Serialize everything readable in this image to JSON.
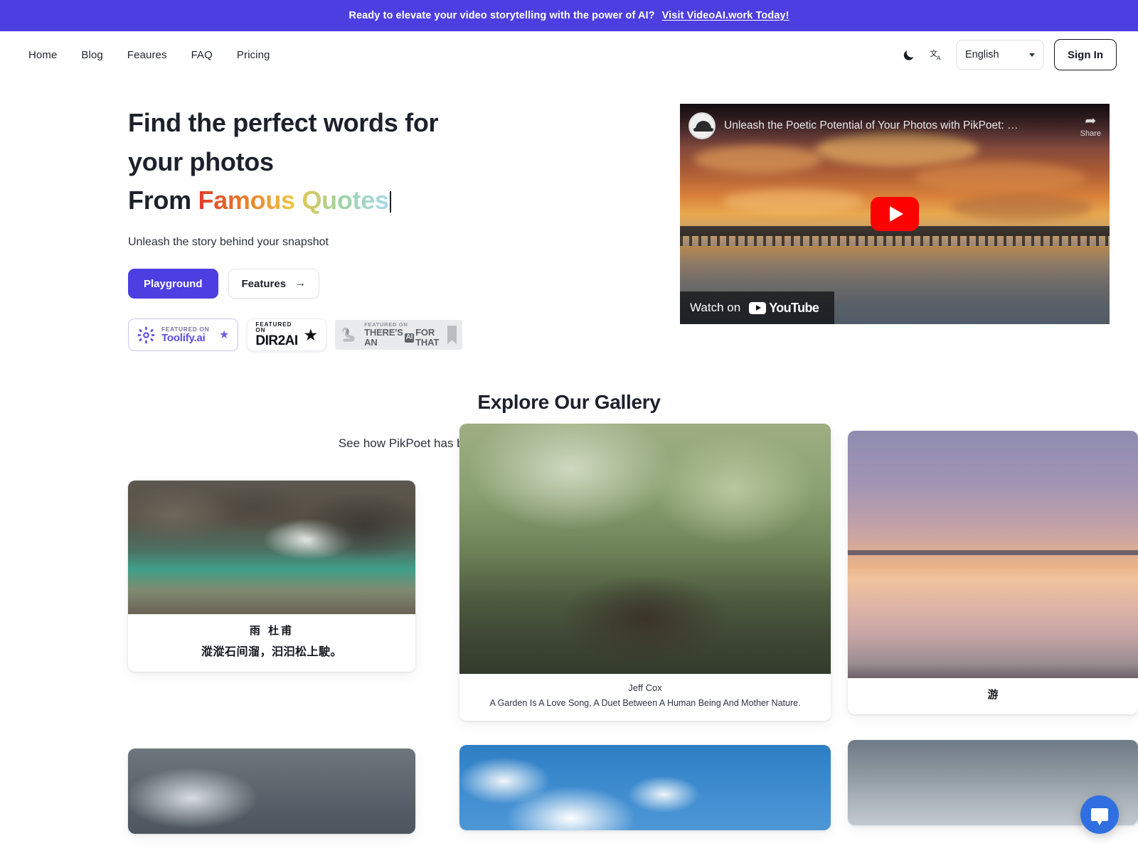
{
  "promo": {
    "text": "Ready to elevate your video storytelling with the power of AI?",
    "link_label": "Visit VideoAI.work Today!",
    "bg_color": "#4c3ee0"
  },
  "header": {
    "nav": [
      {
        "label": "Home"
      },
      {
        "label": "Blog"
      },
      {
        "label": "Feaures"
      },
      {
        "label": "FAQ"
      },
      {
        "label": "Pricing"
      }
    ],
    "theme_toggle_icon": "moon-icon",
    "translate_icon": "translate-icon",
    "language": {
      "value": "English"
    },
    "sign_in_label": "Sign In"
  },
  "hero": {
    "heading_line1": "Find the perfect words for your photos",
    "heading_line2_prefix": "From ",
    "heading_line2_gradient": "Famous Quotes",
    "subtitle": "Unleash the story behind your snapshot",
    "primary_button": "Playground",
    "secondary_button": "Features",
    "secondary_button_icon": "arrow-right-icon",
    "badges": [
      {
        "id": "toolify",
        "featured_label": "FEATURED ON",
        "name": "Toolify.ai",
        "icon": "toolify-gear-icon",
        "trailing_icon": "star-icon",
        "accent": "#5b4de0"
      },
      {
        "id": "dir2ai",
        "featured_label": "FEATURED ON",
        "name": "DIR2AI",
        "trailing_icon": "star-icon",
        "accent": "#0b0e12"
      },
      {
        "id": "theres-an-ai-for-that",
        "featured_label": "FEATURED ON",
        "name_part1": "THERE'S AN",
        "name_chip": "AI",
        "name_part2": "FOR THAT",
        "icon": "flexed-arm-icon",
        "trailing_icon": "flag-icon",
        "accent": "#5d6268"
      }
    ]
  },
  "video": {
    "title": "Unleash the Poetic Potential of Your Photos with PikPoet: …",
    "share_label": "Share",
    "share_icon": "share-arrow-icon",
    "channel_avatar_icon": "channel-avatar-icon",
    "play_icon": "youtube-play-icon",
    "watch_label": "Watch on",
    "platform": "YouTube"
  },
  "gallery": {
    "title": "Explore Our Gallery",
    "description": "See how PikPoet has brought photos to life with poetic captions and beautiful designs.",
    "columns": [
      {
        "cards": [
          {
            "image": "river-waterfall-photo",
            "photo_class": "ph-river",
            "caption_type": "chinese",
            "cn_title": "雨  杜甫",
            "cn_body": "漎漎石间溜，汩汩松上駛。"
          },
          {
            "image": "storm-clouds-photo",
            "photo_class": "ph-storm",
            "caption_type": "none"
          }
        ]
      },
      {
        "cards": [
          {
            "image": "mossy-pavilion-forest-photo",
            "photo_class": "ph-pavilion",
            "caption_type": "english",
            "author": "Jeff Cox",
            "quote": "A Garden Is A Love Song, A Duet Between A Human Being And Mother Nature."
          },
          {
            "image": "blue-sky-clouds-photo",
            "photo_class": "ph-clouds",
            "caption_type": "none"
          }
        ]
      },
      {
        "cards": [
          {
            "image": "sunset-pier-seascape-photo",
            "photo_class": "ph-sunset",
            "caption_type": "chinese-single",
            "cn_title": "游"
          },
          {
            "image": "foggy-gradient-photo",
            "photo_class": "ph-fog",
            "caption_type": "none"
          }
        ]
      }
    ]
  },
  "chat_widget": {
    "icon": "chat-bubble-icon",
    "color": "#2f6fe0"
  }
}
